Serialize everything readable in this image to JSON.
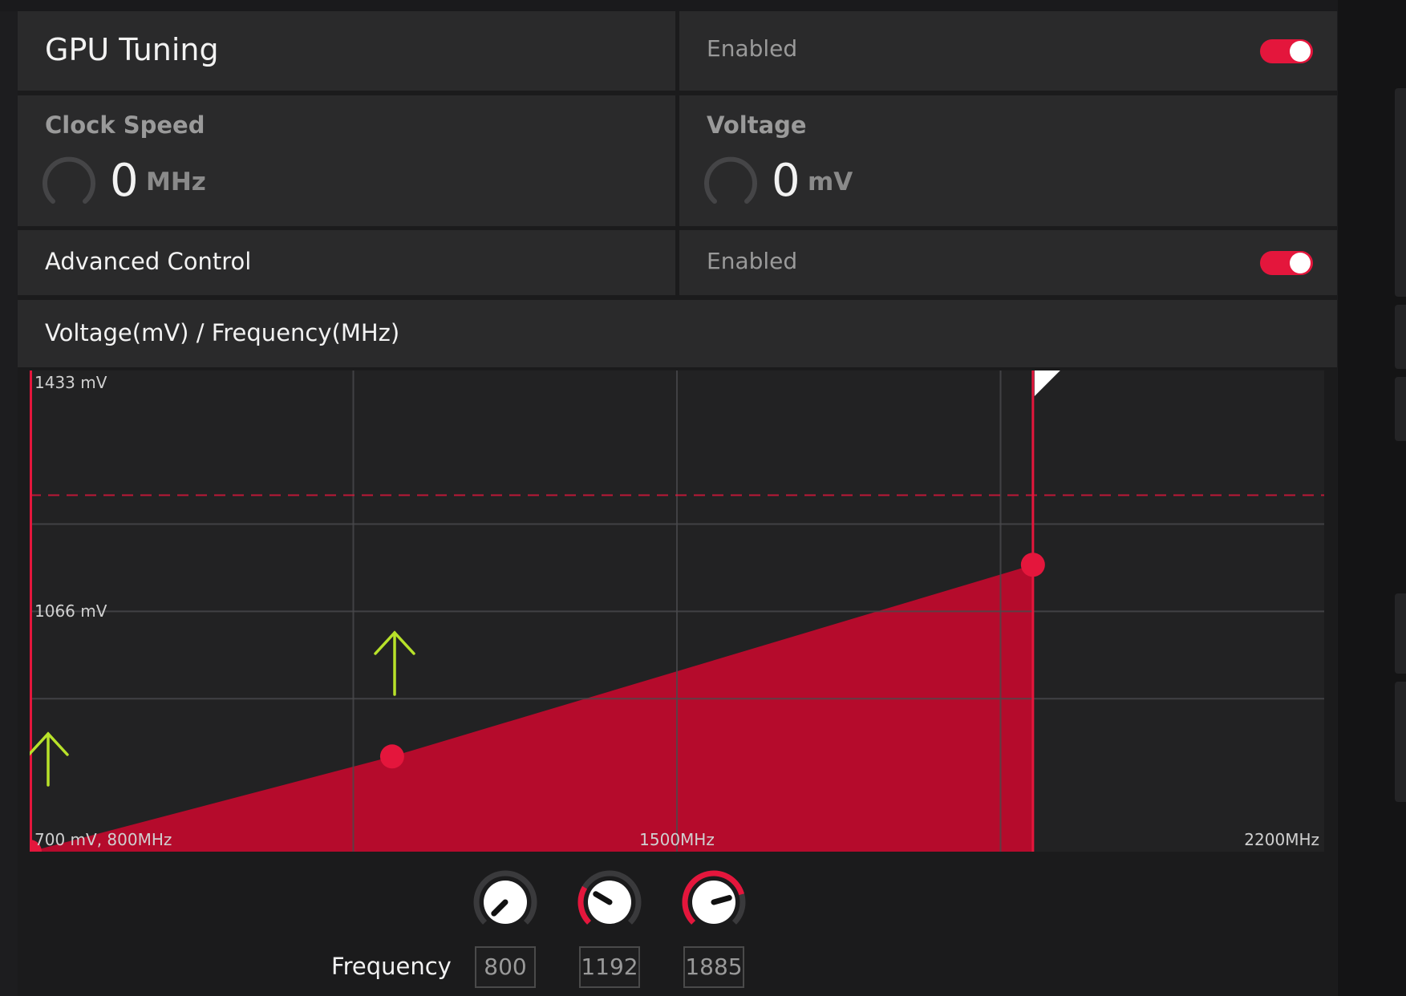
{
  "header": {
    "title": "GPU Tuning",
    "status_label": "Enabled",
    "enabled": true
  },
  "clock_speed": {
    "label": "Clock Speed",
    "value": "0",
    "unit": "MHz"
  },
  "voltage": {
    "label": "Voltage",
    "value": "0",
    "unit": "mV"
  },
  "advanced_control": {
    "label": "Advanced Control",
    "status_label": "Enabled",
    "enabled": true
  },
  "graph_section": {
    "title": "Voltage(mV) / Frequency(MHz)"
  },
  "chart_data": {
    "type": "area",
    "x_range": [
      800,
      2200
    ],
    "y_range": [
      700,
      1433
    ],
    "y_labels": [
      "1433 mV",
      "1066 mV"
    ],
    "x_labels": [
      "700 mV, 800MHz",
      "1500MHz",
      "2200MHz"
    ],
    "points": [
      {
        "freq": 800,
        "mv": 700
      },
      {
        "freq": 1192,
        "mv": 845
      },
      {
        "freq": 1885,
        "mv": 1137
      }
    ],
    "min_limit_freq": 800,
    "max_limit_freq": 1885,
    "voltage_limit_mv": 1243,
    "gridlines_freq": [
      1150,
      1500,
      1850
    ],
    "gridlines_mv": [
      1199,
      1066,
      933
    ],
    "fill_color": "#b50b2c",
    "line_color": "#e4163c",
    "arrow_color": "#b8e22a"
  },
  "frequency_controls": {
    "label": "Frequency",
    "knobs": [
      {
        "value": "800",
        "fraction": 0.0
      },
      {
        "value": "1192",
        "fraction": 0.28
      },
      {
        "value": "1885",
        "fraction": 0.775
      }
    ]
  }
}
